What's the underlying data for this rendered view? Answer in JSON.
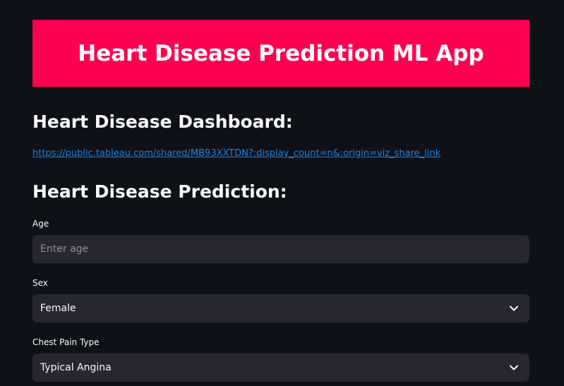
{
  "banner": {
    "title": "Heart Disease Prediction ML App",
    "bg_color": "#ff0050"
  },
  "dashboard": {
    "heading": "Heart Disease Dashboard:",
    "link_text": "https://public.tableau.com/shared/MB93XXTDN?:display_count=n&:origin=viz_share_link"
  },
  "prediction": {
    "heading": "Heart Disease Prediction:",
    "fields": {
      "age": {
        "label": "Age",
        "placeholder": "Enter age",
        "value": ""
      },
      "sex": {
        "label": "Sex",
        "selected": "Female"
      },
      "chest_pain": {
        "label": "Chest Pain Type",
        "selected": "Typical Angina"
      }
    }
  },
  "icons": {
    "dropdown": "chevron-down-icon"
  },
  "colors": {
    "background": "#0e1117",
    "input_bg": "#262730",
    "link": "#1c83e1"
  }
}
